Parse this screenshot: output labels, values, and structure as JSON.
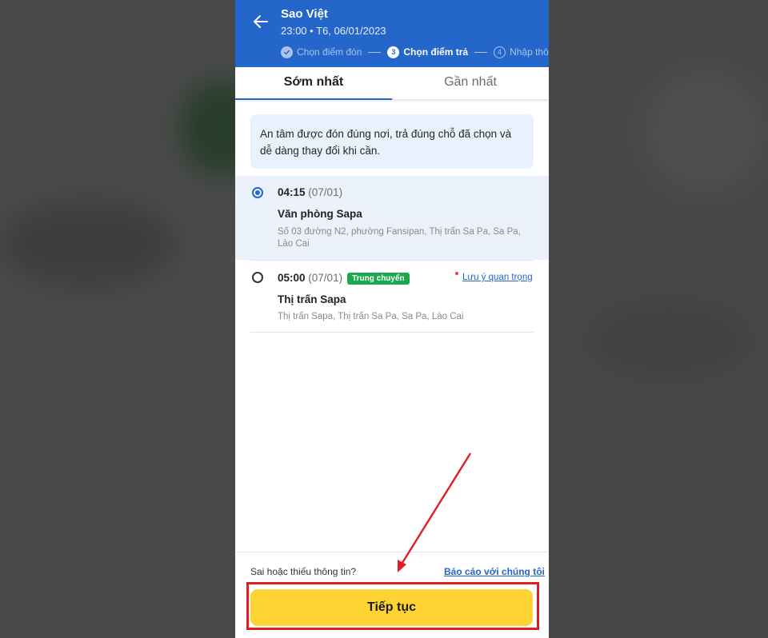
{
  "header": {
    "title": "Sao Việt",
    "subtitle": "23:00 • T6, 06/01/2023",
    "steps": [
      {
        "number": "✓",
        "label": "Chọn điểm đón",
        "state": "done"
      },
      {
        "number": "3",
        "label": "Chọn điểm trả",
        "state": "active"
      },
      {
        "number": "4",
        "label": "Nhập thôn",
        "state": "todo"
      }
    ]
  },
  "tabs": [
    {
      "label": "Sớm nhất",
      "active": true
    },
    {
      "label": "Gần nhất",
      "active": false
    }
  ],
  "notice": "An tâm được đón đúng nơi, trả đúng chỗ đã chọn và dễ dàng thay đổi khi cần.",
  "options": [
    {
      "time": "04:15",
      "date": "(07/01)",
      "name": "Văn phòng Sapa",
      "address": "Số 03 đường N2, phường Fansipan, Thị trấn Sa Pa, Sa Pa, Lào Cai",
      "selected": true
    },
    {
      "time": "05:00",
      "date": "(07/01)",
      "badge": "Trung chuyển",
      "note_link": "Lưu ý quan trọng",
      "name": "Thị trấn Sapa",
      "address": "Thị trấn Sapa, Thị trấn Sa Pa, Sa Pa, Lào Cai",
      "selected": false
    }
  ],
  "footer": {
    "report_question": "Sai hoặc thiếu thông tin?",
    "report_link": "Báo cáo với chúng tôi",
    "continue_label": "Tiếp tục"
  },
  "colors": {
    "header_blue": "#2566cb",
    "button_yellow": "#ffd334",
    "badge_green": "#1ea84e",
    "annotation_red": "#e01e22"
  }
}
